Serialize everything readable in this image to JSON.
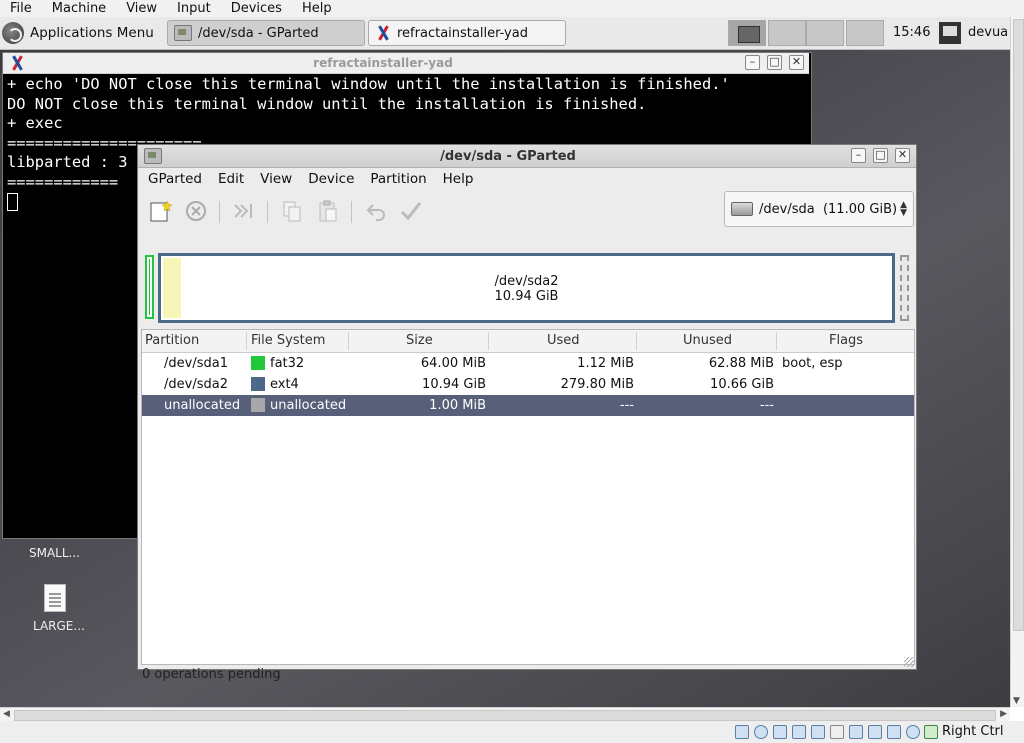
{
  "vbox": {
    "menu": [
      "File",
      "Machine",
      "View",
      "Input",
      "Devices",
      "Help"
    ],
    "host_key": "Right Ctrl"
  },
  "panel": {
    "apps_menu": "Applications Menu",
    "tasks": [
      {
        "label": "/dev/sda - GParted",
        "active": true
      },
      {
        "label": "refractainstaller-yad",
        "active": false
      }
    ],
    "clock": "15:46",
    "user": "devua"
  },
  "terminal": {
    "title": "refractainstaller-yad",
    "lines": [
      "+ echo 'DO NOT close this terminal window until the installation is finished.'",
      "DO NOT close this terminal window until the installation is finished.",
      "+ exec",
      "=====================",
      "libparted : 3",
      "============"
    ]
  },
  "desktop": {
    "icons": [
      "SMALL...",
      "LARGE..."
    ]
  },
  "gparted": {
    "title": "/dev/sda - GParted",
    "menu": [
      "GParted",
      "Edit",
      "View",
      "Device",
      "Partition",
      "Help"
    ],
    "device_selector": "/dev/sda  (11.00 GiB)",
    "diskmap": {
      "name": "/dev/sda2",
      "size": "10.94 GiB"
    },
    "columns": [
      "Partition",
      "File System",
      "Size",
      "Used",
      "Unused",
      "Flags"
    ],
    "rows": [
      {
        "partition": "/dev/sda1",
        "fs": "fat32",
        "color": "#21c93a",
        "size": "64.00 MiB",
        "used": "1.12 MiB",
        "unused": "62.88 MiB",
        "flags": "boot, esp"
      },
      {
        "partition": "/dev/sda2",
        "fs": "ext4",
        "color": "#4b6a8a",
        "size": "10.94 GiB",
        "used": "279.80 MiB",
        "unused": "10.66 GiB",
        "flags": ""
      },
      {
        "partition": "unallocated",
        "fs": "unallocated",
        "color": "#a8a8a8",
        "size": "1.00 MiB",
        "used": "---",
        "unused": "---",
        "flags": ""
      }
    ],
    "status": "0 operations pending"
  }
}
